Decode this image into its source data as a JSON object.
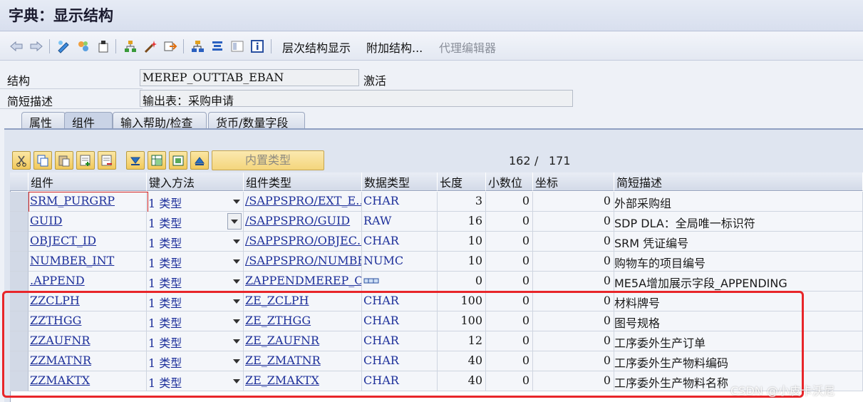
{
  "window": {
    "title": "字典：显示结构"
  },
  "toolbar": {
    "icons": [
      "back-arrow-icon",
      "forward-arrow-icon",
      "display-change-icon",
      "other-object-icon",
      "activate-icon",
      "where-used-icon",
      "wand-icon",
      "navigate-icon",
      "hierarchy-icon",
      "stack-icon",
      "layout-icon",
      "info-icon"
    ],
    "hierarchy_display": "层次结构显示",
    "append_structure": "附加结构...",
    "proxy_editor": "代理编辑器"
  },
  "header": {
    "structure_label": "结构",
    "structure_value": "MEREP_OUTTAB_EBAN",
    "status": "激活",
    "short_desc_label": "简短描述",
    "short_desc_value": "输出表：采购申请"
  },
  "tabs": [
    {
      "label": "属性",
      "active": false
    },
    {
      "label": "组件",
      "active": true
    },
    {
      "label": "输入帮助/检查",
      "active": false
    },
    {
      "label": "货币/数量字段",
      "active": false
    }
  ],
  "table_toolbar": {
    "builtin_type_label": "内置类型",
    "counter_current": "162",
    "counter_sep": "/",
    "counter_total": "171"
  },
  "columns": [
    "组件",
    "键入方法",
    "组件类型",
    "数据类型",
    "长度",
    "小数位",
    "坐标",
    "简短描述"
  ],
  "rows": [
    {
      "component": "SRM_PURGRP",
      "method": "1 类型",
      "type": "/SAPPSPRO/EXT_E…",
      "dtype": "CHAR",
      "length": "3",
      "decimals": "0",
      "coord": "0",
      "desc": "外部采购组"
    },
    {
      "component": "GUID",
      "method": "1 类型",
      "type": "/SAPPSPRO/GUID",
      "dtype": "RAW",
      "length": "16",
      "decimals": "0",
      "coord": "0",
      "desc": "SDP DLA：全局唯一标识符"
    },
    {
      "component": "OBJECT_ID",
      "method": "1 类型",
      "type": "/SAPPSPRO/OBJEC…",
      "dtype": "CHAR",
      "length": "10",
      "decimals": "0",
      "coord": "0",
      "desc": "SRM 凭证编号"
    },
    {
      "component": "NUMBER_INT",
      "method": "1 类型",
      "type": "/SAPPSPRO/NUMBE…",
      "dtype": "NUMC",
      "length": "10",
      "decimals": "0",
      "coord": "0",
      "desc": "购物车的项目编号"
    },
    {
      "component": ".APPEND",
      "method": "1 类型",
      "type": "ZAPPENDMEREP_OU…",
      "dtype": "",
      "length": "0",
      "decimals": "0",
      "coord": "0",
      "desc": "ME5A增加展示字段_APPENDING"
    },
    {
      "component": "ZZCLPH",
      "method": "1 类型",
      "type": "ZE_ZCLPH",
      "dtype": "CHAR",
      "length": "100",
      "decimals": "0",
      "coord": "0",
      "desc": "材料牌号"
    },
    {
      "component": "ZZTHGG",
      "method": "1 类型",
      "type": "ZE_ZTHGG",
      "dtype": "CHAR",
      "length": "100",
      "decimals": "0",
      "coord": "0",
      "desc": "图号规格"
    },
    {
      "component": "ZZAUFNR",
      "method": "1 类型",
      "type": "ZE_ZAUFNR",
      "dtype": "CHAR",
      "length": "12",
      "decimals": "0",
      "coord": "0",
      "desc": "工序委外生产订单"
    },
    {
      "component": "ZZMATNR",
      "method": "1 类型",
      "type": "ZE_ZMATNR",
      "dtype": "CHAR",
      "length": "40",
      "decimals": "0",
      "coord": "0",
      "desc": "工序委外生产物料编码"
    },
    {
      "component": "ZZMAKTX",
      "method": "1 类型",
      "type": "ZE_ZMAKTX",
      "dtype": "CHAR",
      "length": "40",
      "decimals": "0",
      "coord": "0",
      "desc": "工序委外生产物料名称"
    }
  ],
  "watermark": "CSDN @小皮卡沃尼",
  "colors": {
    "highlight": "#e8262a",
    "link": "#1d2f9a"
  }
}
